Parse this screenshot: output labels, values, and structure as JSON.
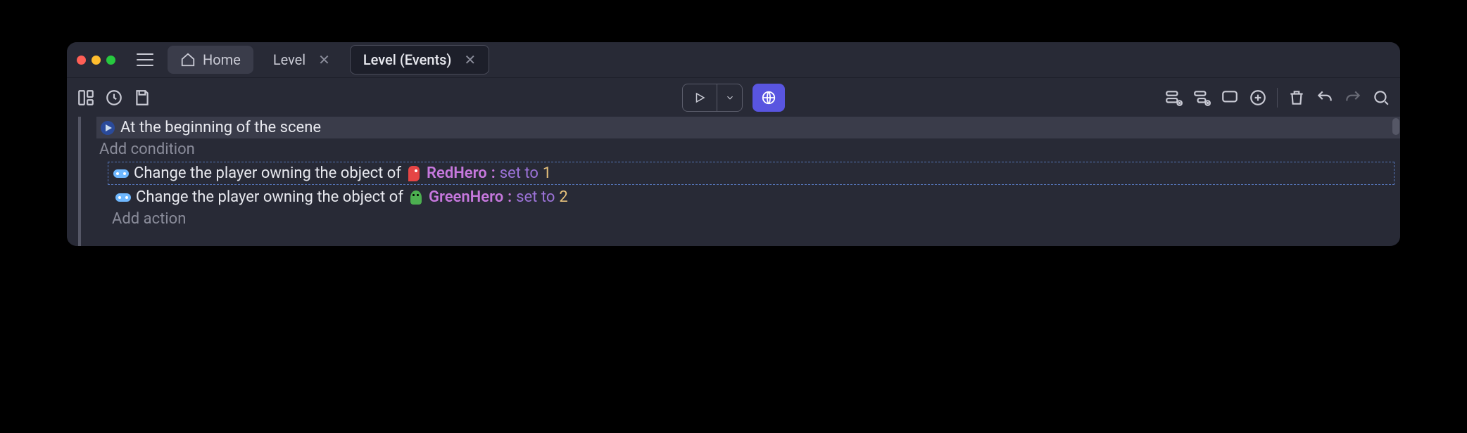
{
  "tabs": {
    "home": "Home",
    "level": "Level",
    "level_events": "Level (Events)"
  },
  "events": {
    "condition_label": "At the beginning of the scene",
    "add_condition": "Add condition",
    "add_action": "Add action",
    "action_prefix": "Change the player owning the object of ",
    "action1": {
      "object": "RedHero",
      "sep": ": ",
      "setto": "set to ",
      "value": "1"
    },
    "action2": {
      "object": "GreenHero",
      "sep": ": ",
      "setto": "set to ",
      "value": "2"
    }
  }
}
